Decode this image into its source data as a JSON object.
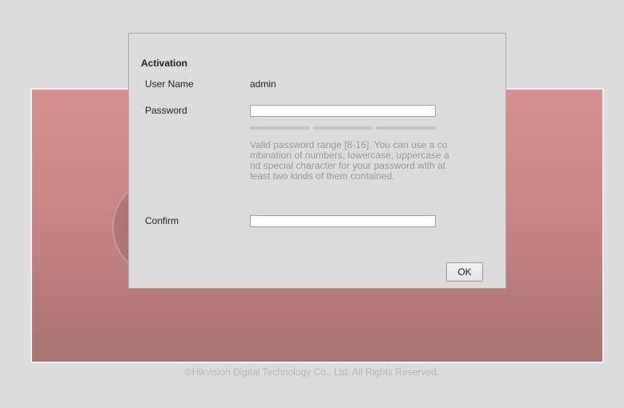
{
  "dialog": {
    "title": "Activation",
    "user_name_label": "User Name",
    "user_name_value": "admin",
    "password_label": "Password",
    "password_value": "",
    "hint": "Valid password range [8-16]. You can use a combination of numbers, lowercase, uppercase and special character for your password with at least two kinds of them contained.",
    "confirm_label": "Confirm",
    "confirm_value": "",
    "ok_label": "OK"
  },
  "footer": {
    "copyright": "©Hikvision Digital Technology Co., Ltd. All Rights Reserved."
  }
}
